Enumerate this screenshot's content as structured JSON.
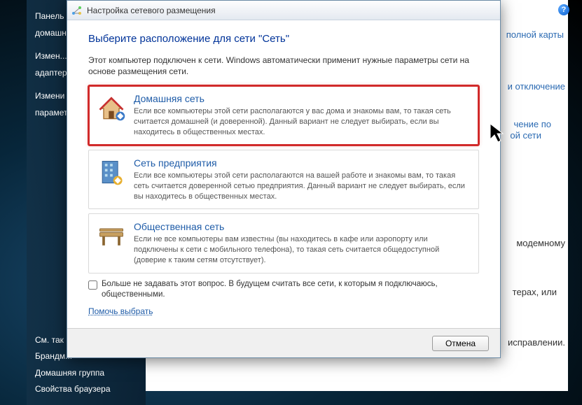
{
  "sidebar": {
    "items": [
      "Панель",
      "домашн...",
      "Измен...",
      "адаптер...",
      "Измени",
      "парамет..."
    ],
    "bottom": [
      "См. так",
      "Брандм...",
      "Домашняя группа",
      "Свойства браузера"
    ]
  },
  "background": {
    "link_map": "полной карты",
    "link_disable": "и отключение",
    "link_conn1": "чение по",
    "link_conn2": "ой сети",
    "text_modem": "модемному",
    "text_or": "терах, или",
    "text_fix": "исправлении."
  },
  "dialog": {
    "title": "Настройка сетевого размещения",
    "heading": "Выберите расположение для сети \"Сеть\"",
    "intro": "Этот компьютер подключен к сети. Windows автоматически применит нужные параметры сети на основе размещения сети.",
    "options": [
      {
        "title": "Домашняя сеть",
        "desc": "Если все компьютеры этой сети располагаются у вас дома и знакомы вам, то такая сеть считается домашней (и доверенной). Данный вариант не следует выбирать, если вы находитесь в общественных местах."
      },
      {
        "title": "Сеть предприятия",
        "desc": "Если все компьютеры этой сети располагаются на вашей работе и знакомы вам, то такая сеть считается доверенной сетью предприятия. Данный вариант не следует выбирать, если вы находитесь в общественных местах."
      },
      {
        "title": "Общественная сеть",
        "desc": "Если не все компьютеры вам известны (вы находитесь в кафе или аэропорту или подключены к сети с мобильного телефона), то такая сеть считается общедоступной (доверие к таким сетям отсутствует)."
      }
    ],
    "checkbox_label": "Больше не задавать этот вопрос. В будущем считать все сети, к которым я подключаюсь, общественными.",
    "help_link": "Помочь выбрать",
    "cancel": "Отмена"
  }
}
